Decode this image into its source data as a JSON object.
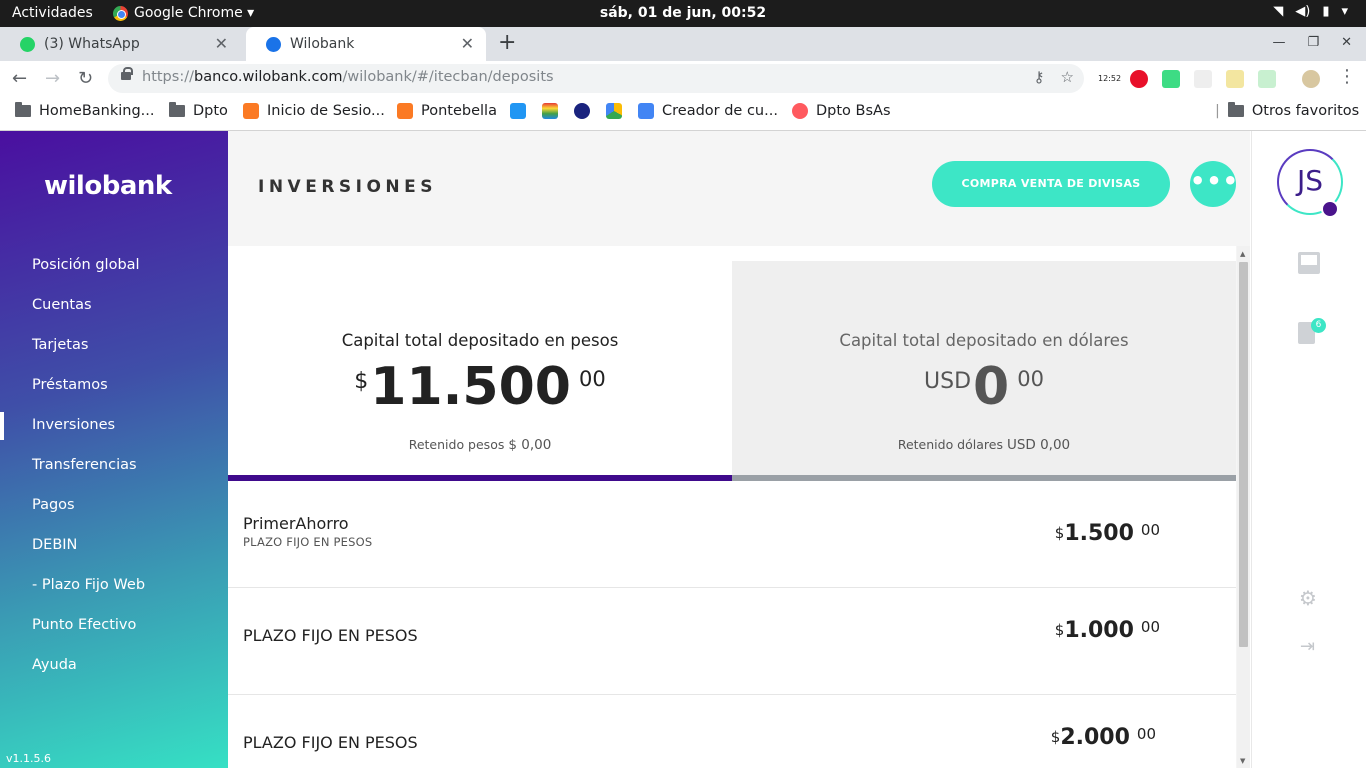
{
  "os": {
    "activities": "Actividades",
    "app_name": "Google Chrome ▾",
    "clock": "sáb, 01 de jun, 00:52"
  },
  "tabs": [
    {
      "title": "(3) WhatsApp",
      "favicon_color": "#25d366"
    },
    {
      "title": "Wilobank",
      "favicon_color": "#1a73e8"
    }
  ],
  "omnibox": {
    "url_scheme": "https://",
    "url_host": "banco.wilobank.com",
    "url_path": "/wilobank/#/itecban/deposits"
  },
  "extensions": [
    "12:52"
  ],
  "bookmarks": {
    "items": [
      {
        "label": "HomeBanking...",
        "icon": "folder-icon"
      },
      {
        "label": "Dpto",
        "icon": "folder-icon"
      },
      {
        "label": "Inicio de Sesio...",
        "icon": "xampp-icon"
      },
      {
        "label": "Pontebella",
        "icon": "xampp-icon"
      },
      {
        "label": "Creador de cu...",
        "icon": "filter-icon"
      },
      {
        "label": "Dpto BsAs",
        "icon": "airbnb-icon"
      }
    ],
    "other": "Otros favoritos"
  },
  "app": {
    "logo": "wilobank",
    "version": "v1.1.5.6",
    "nav": [
      {
        "label": "Posición global",
        "active": false
      },
      {
        "label": "Cuentas",
        "active": false
      },
      {
        "label": "Tarjetas",
        "active": false
      },
      {
        "label": "Préstamos",
        "active": false
      },
      {
        "label": "Inversiones",
        "active": true
      },
      {
        "label": "Transferencias",
        "active": false
      },
      {
        "label": "Pagos",
        "active": false
      },
      {
        "label": "DEBIN",
        "active": false
      },
      {
        "label": "- Plazo Fijo Web",
        "active": false
      },
      {
        "label": "Punto Efectivo",
        "active": false
      },
      {
        "label": "Ayuda",
        "active": false
      }
    ],
    "page_title": "INVERSIONES",
    "fx_button": "COMPRA VENTA DE DIVISAS",
    "more_button": "•••",
    "capital": {
      "pesos": {
        "title": "Capital total depositado en pesos",
        "currency": "$",
        "amount": "11.500",
        "cents": "00",
        "retained_label": "Retenido pesos",
        "retained_value": "$ 0,00"
      },
      "dolares": {
        "title": "Capital total depositado en dólares",
        "currency": "USD",
        "amount": "0",
        "cents": "00",
        "retained_label": "Retenido dólares",
        "retained_value": "USD 0,00"
      }
    },
    "deposits": [
      {
        "name": "PrimerAhorro",
        "type": "PLAZO FIJO EN PESOS",
        "currency": "$",
        "amount": "1.500",
        "cents": "00"
      },
      {
        "name": "PLAZO FIJO EN PESOS",
        "type": "",
        "currency": "$",
        "amount": "1.000",
        "cents": "00"
      },
      {
        "name": "PLAZO FIJO EN PESOS",
        "type": "",
        "currency": "$",
        "amount": "2.000",
        "cents": "00"
      }
    ],
    "user_initials": "JS",
    "doc_badge": "6"
  },
  "colors": {
    "accent": "#3de6c6",
    "brand_purple": "#3f0a8c"
  }
}
